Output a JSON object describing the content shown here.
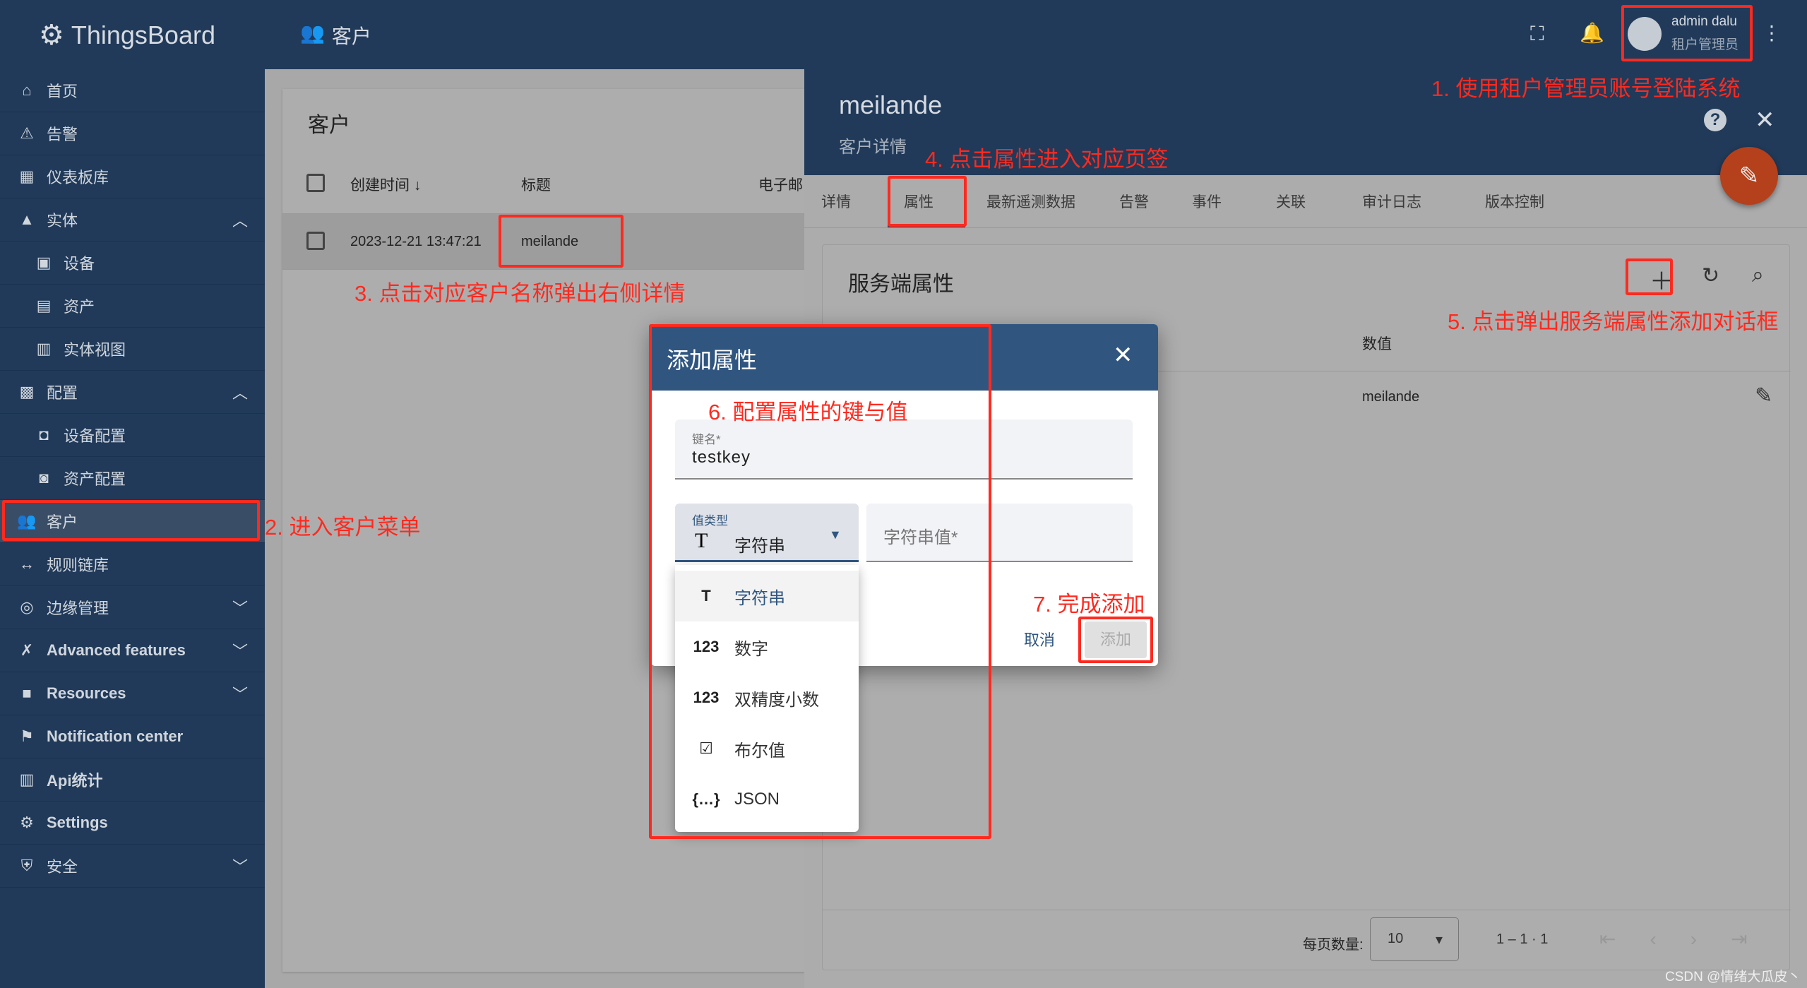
{
  "app": {
    "name": "ThingsBoard",
    "page_title": "客户"
  },
  "sidebar": {
    "items": [
      {
        "label": "首页",
        "icon": "home-icon"
      },
      {
        "label": "告警",
        "icon": "warning-icon"
      },
      {
        "label": "仪表板库",
        "icon": "dashboard-icon"
      },
      {
        "label": "实体",
        "icon": "entity-icon",
        "expanded": true
      },
      {
        "label": "设备",
        "icon": "device-icon"
      },
      {
        "label": "资产",
        "icon": "asset-icon"
      },
      {
        "label": "实体视图",
        "icon": "entity-view-icon"
      },
      {
        "label": "配置",
        "icon": "profile-icon",
        "expanded": true
      },
      {
        "label": "设备配置",
        "icon": "device-profile-icon"
      },
      {
        "label": "资产配置",
        "icon": "asset-profile-icon"
      },
      {
        "label": "客户",
        "icon": "customers-icon",
        "active": true
      },
      {
        "label": "规则链库",
        "icon": "rule-chain-icon"
      },
      {
        "label": "边缘管理",
        "icon": "edge-icon"
      },
      {
        "label": "Advanced features",
        "icon": "tools-icon"
      },
      {
        "label": "Resources",
        "icon": "folder-icon"
      },
      {
        "label": "Notification center",
        "icon": "notification-icon"
      },
      {
        "label": "Api统计",
        "icon": "chart-icon"
      },
      {
        "label": "Settings",
        "icon": "gear-icon"
      },
      {
        "label": "安全",
        "icon": "shield-icon"
      }
    ]
  },
  "user": {
    "name": "admin dalu",
    "role": "租户管理员"
  },
  "customers": {
    "title": "客户",
    "columns": [
      "创建时间",
      "标题",
      "电子邮"
    ],
    "rows": [
      {
        "created": "2023-12-21 13:47:21",
        "title": "meilande"
      }
    ]
  },
  "details": {
    "title": "meilande",
    "subtitle": "客户详情",
    "tabs": [
      "详情",
      "属性",
      "最新遥测数据",
      "告警",
      "事件",
      "关联",
      "审计日志",
      "版本控制"
    ],
    "active_tab": "属性",
    "section_title": "服务端属性",
    "value_col": "数值",
    "row_value": "meilande",
    "paging": {
      "label": "每页数量:",
      "page_size": "10",
      "range": "1 – 1 · 1"
    }
  },
  "dialog": {
    "title": "添加属性",
    "key_label": "键名*",
    "key_value": "testkey",
    "type_label": "值类型",
    "type_value": "字符串",
    "value_placeholder": "字符串值*",
    "cancel": "取消",
    "add": "添加",
    "options": [
      {
        "icon": "T",
        "label": "字符串"
      },
      {
        "icon": "123",
        "label": "数字"
      },
      {
        "icon": "123",
        "label": "双精度小数"
      },
      {
        "icon": "☑",
        "label": "布尔值"
      },
      {
        "icon": "{…}",
        "label": "JSON"
      }
    ]
  },
  "annotations": [
    "1. 使用租户管理员账号登陆系统",
    "2. 进入客户菜单",
    "3. 点击对应客户名称弹出右侧详情",
    "4. 点击属性进入对应页签",
    "5. 点击弹出服务端属性添加对话框",
    "6. 配置属性的键与值",
    "7. 完成添加"
  ],
  "watermark": "CSDN @情绪大瓜皮丶",
  "colors": {
    "nav": "#213a59",
    "dialog_header": "#305680",
    "annotation": "#ff2a1f",
    "fab": "#b5401c"
  }
}
